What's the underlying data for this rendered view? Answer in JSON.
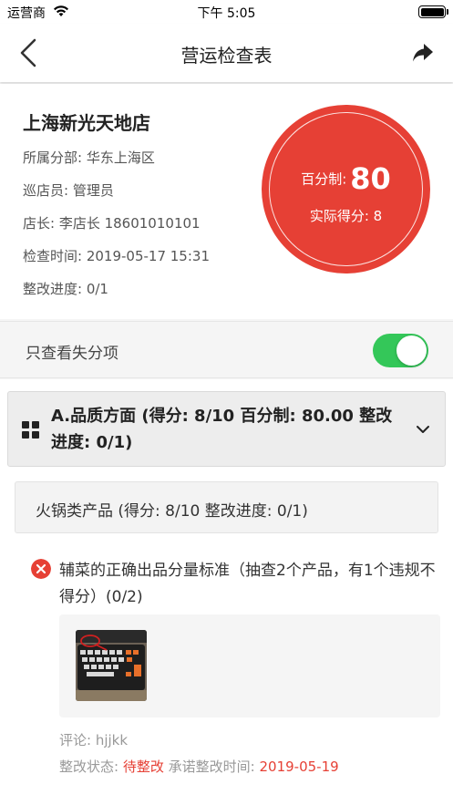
{
  "status_bar": {
    "carrier": "运营商",
    "time": "下午 5:05"
  },
  "nav": {
    "title": "营运检查表",
    "back_icon": "chevron-left-icon",
    "share_icon": "share-arrow-icon"
  },
  "store": {
    "name": "上海新光天地店",
    "division": "所属分部: 华东上海区",
    "inspector": "巡店员: 管理员",
    "manager": "店长: 李店长 18601010101",
    "check_time": "检查时间: 2019-05-17 15:31",
    "progress": "整改进度: 0/1"
  },
  "score": {
    "percent_label": "百分制:",
    "percent_value": "80",
    "actual": "实际得分: 8",
    "circle_color": "#e64035"
  },
  "filter": {
    "label": "只查看失分项",
    "enabled": true,
    "switch_color": "#34c759"
  },
  "section": {
    "title": "A.品质方面 (得分: 8/10 百分制: 80.00 整改进度: 0/1)"
  },
  "subsection": {
    "title": "火锅类产品 (得分: 8/10 整改进度: 0/1)"
  },
  "item": {
    "text": "辅菜的正确出品分量标准（抽查2个产品，有1个违规不得分）(0/2)",
    "comment": "评论: hjjkk",
    "status_label": "整改状态:",
    "status_value": "待整改",
    "deadline_label": "承诺整改时间:",
    "deadline_value": "2019-05-19"
  }
}
